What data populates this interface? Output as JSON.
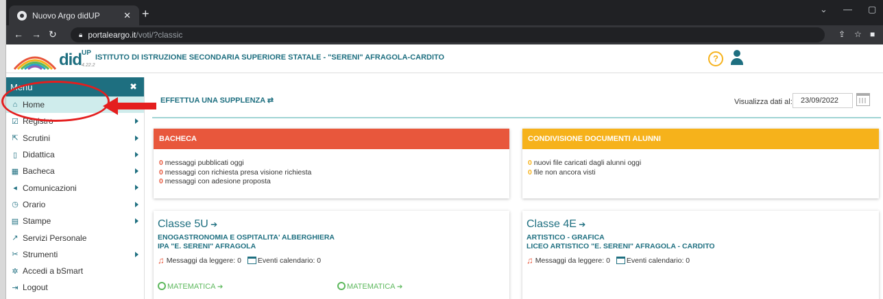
{
  "browser": {
    "tab_title": "Nuovo Argo didUP",
    "url_host": "portaleargo.it",
    "url_path": "/voti/?classic"
  },
  "header": {
    "brand": "did",
    "brand_sup": "UP",
    "version": "4.22.2",
    "school_name": "ISTITUTO DI ISTRUZIONE SECONDARIA SUPERIORE STATALE - \"SERENI\" AFRAGOLA-CARDITO",
    "help_label": "?"
  },
  "sidebar": {
    "title": "Menu",
    "close_label": "✖",
    "items": [
      {
        "label": "Home",
        "icon": "⌂"
      },
      {
        "label": "Registro",
        "icon": "☑"
      },
      {
        "label": "Scrutini",
        "icon": "⇱"
      },
      {
        "label": "Didattica",
        "icon": "▯"
      },
      {
        "label": "Bacheca",
        "icon": "▦"
      },
      {
        "label": "Comunicazioni",
        "icon": "◂"
      },
      {
        "label": "Orario",
        "icon": "◷"
      },
      {
        "label": "Stampe",
        "icon": "▤"
      },
      {
        "label": "Servizi Personale",
        "icon": "↗"
      },
      {
        "label": "Strumenti",
        "icon": "✂"
      },
      {
        "label": "Accedi a bSmart",
        "icon": "✲"
      },
      {
        "label": "Logout",
        "icon": "⇥"
      }
    ]
  },
  "main": {
    "supplenza_label": "EFFETTUA UNA SUPPLENZA",
    "visualizza_label": "Visualizza dati al:",
    "date_value": "23/09/2022",
    "bacheca": {
      "title": "BACHECA",
      "color": "#e8573c",
      "lines": [
        {
          "count": "0",
          "text": " messaggi pubblicati oggi"
        },
        {
          "count": "0",
          "text": " messaggi con richiesta presa visione richiesta"
        },
        {
          "count": "0",
          "text": " messaggi con adesione proposta"
        }
      ]
    },
    "condivisione": {
      "title": "CONDIVISIONE DOCUMENTI ALUNNI",
      "color": "#f6b21b",
      "lines": [
        {
          "count": "0",
          "text": " nuovi file caricati dagli alunni oggi"
        },
        {
          "count": "0",
          "text": " file non ancora visti"
        }
      ]
    },
    "classes": [
      {
        "title": "Classe 5U",
        "course": "ENOGASTRONOMIA E OSPITALITA' ALBERGHIERA",
        "school": "IPA \"E. SERENI\" AFRAGOLA",
        "messages": "Messaggi da leggere: 0",
        "events": "Eventi calendario: 0",
        "subjects": [
          "MATEMATICA",
          "MATEMATICA"
        ]
      },
      {
        "title": "Classe 4E",
        "course": "ARTISTICO - GRAFICA",
        "school": "LICEO ARTISTICO \"E. SERENI\" AFRAGOLA - CARDITO",
        "messages": "Messaggi da leggere: 0",
        "events": "Eventi calendario: 0"
      }
    ]
  }
}
